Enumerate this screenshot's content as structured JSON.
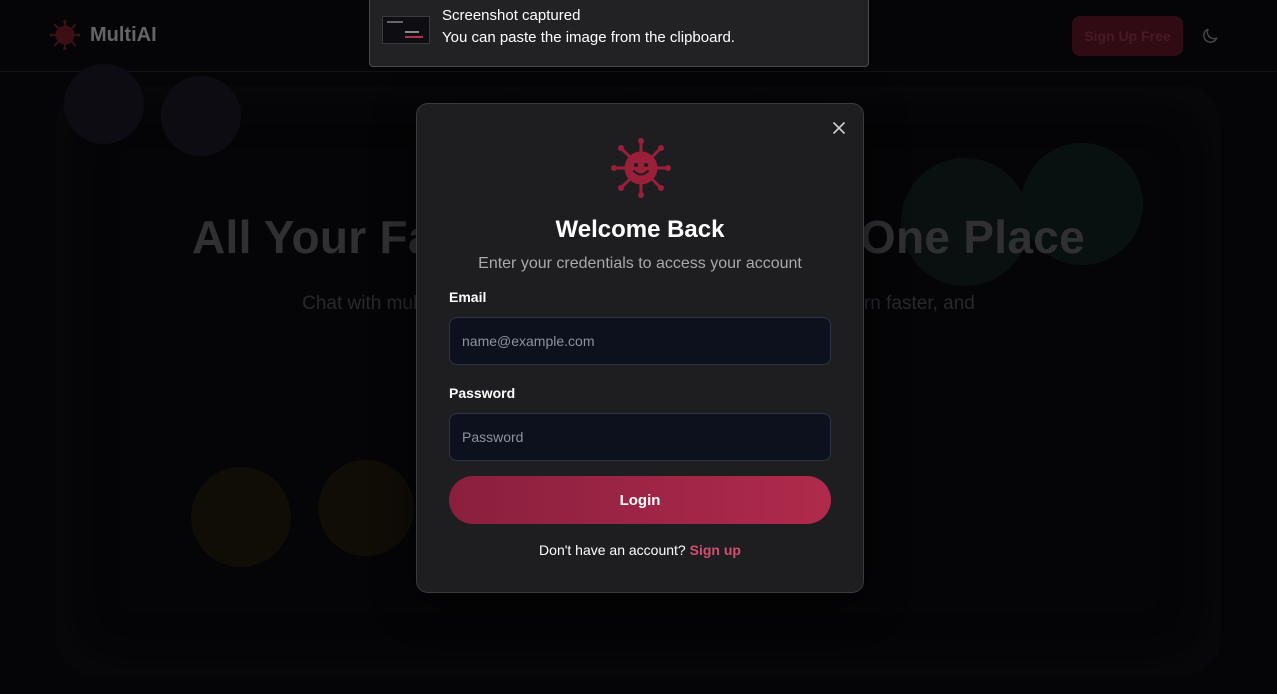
{
  "app": {
    "brand_name": "MultiAI",
    "logo_icon": "virus-smiley-icon",
    "accent_color": "#b02a4c"
  },
  "nav": {
    "signup_label": "Sign Up Free",
    "theme_icon": "moon-icon"
  },
  "hero": {
    "title": "All Your Favorite AI Models in One Place",
    "subtitle": "Chat with multiple AI models side by side. Compare responses, learn faster, and find the best assistant for every task."
  },
  "toast": {
    "title": "Screenshot captured",
    "message": "You can paste the image from the clipboard."
  },
  "login_modal": {
    "title": "Welcome Back",
    "subtitle": "Enter your credentials to access your account",
    "email_label": "Email",
    "email_placeholder": "name@example.com",
    "password_label": "Password",
    "password_placeholder": "Password",
    "login_button": "Login",
    "no_account_text": "Don't have an account?",
    "signup_link": "Sign up",
    "close_icon": "close-icon"
  }
}
